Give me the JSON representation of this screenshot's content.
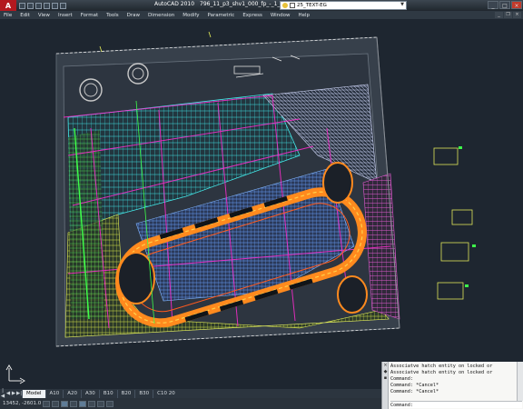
{
  "window": {
    "app_title": "AutoCAD 2010",
    "document_name": "796_11_p3_shv1_000_fp_-_1_0_..."
  },
  "toolbar": {
    "layer_value": "25_TEXT-EG"
  },
  "menu": {
    "items": [
      "File",
      "Edit",
      "View",
      "Insert",
      "Format",
      "Tools",
      "Draw",
      "Dimension",
      "Modify",
      "Parametric",
      "Express",
      "Window",
      "Help"
    ]
  },
  "layout_tabs": {
    "items": [
      "Model",
      "A10",
      "A20",
      "A30",
      "B10",
      "B20",
      "B30",
      "C10 20"
    ],
    "active": "Model"
  },
  "status": {
    "coordinates": "13452, -2601.0"
  },
  "command": {
    "history": [
      "Associatve hatch entity on locked or",
      "Associatve hatch entity on locked or",
      "Command:",
      "Command: *Cancel*",
      "Command: *Cancel*"
    ],
    "prompt": "Command:"
  },
  "colors": {
    "background": "#1f2731",
    "site_fill": "#2e3640",
    "corridor_orange": "#ff8a1e",
    "magenta": "#ff2bd0",
    "cyan": "#34e8e8",
    "yellow": "#e9f05a",
    "green": "#3dff4a"
  },
  "icons": [
    "autocad-logo-icon",
    "layer-lamp-icon",
    "minimize-icon",
    "maximize-icon",
    "close-icon"
  ]
}
